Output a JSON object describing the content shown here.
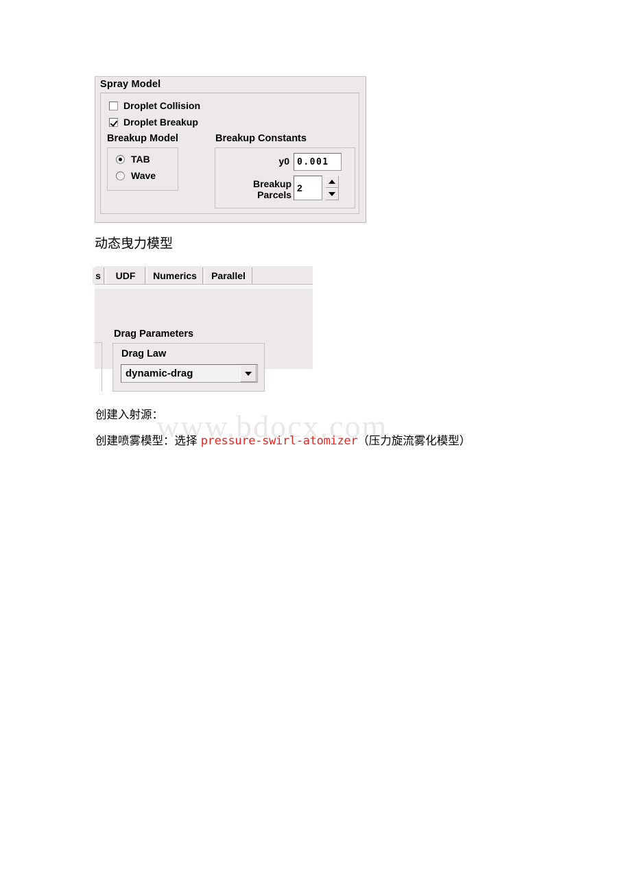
{
  "document": {
    "watermark": "www.bdocx.com"
  },
  "spray_model_panel": {
    "title": "Spray Model",
    "checkboxes": [
      {
        "label": "Droplet Collision",
        "checked": false
      },
      {
        "label": "Droplet Breakup",
        "checked": true
      }
    ],
    "breakup_model": {
      "title": "Breakup Model",
      "options": [
        {
          "label": "TAB",
          "selected": true
        },
        {
          "label": "Wave",
          "selected": false
        }
      ]
    },
    "breakup_constants": {
      "title": "Breakup Constants",
      "fields": [
        {
          "label": "y0",
          "value": "0.001"
        },
        {
          "label": "Breakup Parcels",
          "value": "2"
        }
      ],
      "spinner": {
        "up_icon": "triangle-up-icon",
        "down_icon": "triangle-down-icon"
      }
    }
  },
  "drag_panel": {
    "tabs": [
      {
        "label": "s",
        "truncated": true
      },
      {
        "label": "UDF",
        "truncated": false
      },
      {
        "label": "Numerics",
        "truncated": false
      },
      {
        "label": "Parallel",
        "truncated": false
      }
    ],
    "drag_parameters": {
      "title": "Drag Parameters",
      "drag_law": {
        "label": "Drag Law",
        "value": "dynamic-drag",
        "dropdown_icon": "chevron-down-icon"
      }
    }
  },
  "body_text": {
    "heading_dynamic_drag": "动态曳力模型",
    "line_create_injection": "创建入射源：",
    "line_create_spray_prefix": "创建喷雾模型：选择 ",
    "line_create_spray_code": "pressure-swirl-atomizer",
    "line_create_spray_suffix": "（压力旋流雾化模型）"
  },
  "colors": {
    "panel_bg": "#ece8ec",
    "field_bg": "#ffffff",
    "code_red": "#e8241c",
    "watermark_gray": "#e9e7e9"
  }
}
